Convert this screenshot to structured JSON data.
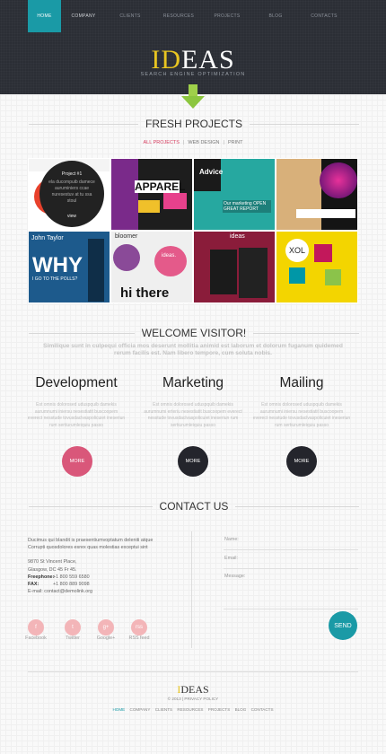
{
  "nav": {
    "items": [
      "HOME",
      "COMPANY",
      "CLIENTS",
      "RESOURCES",
      "PROJECTS",
      "BLOG",
      "CONTACTS"
    ]
  },
  "logo": {
    "highlight": "ID",
    "rest": "EAS",
    "tagline": "SEARCH ENGINE OPTIMIZATION"
  },
  "projects": {
    "title": "FRESH PROJECTS",
    "filters": [
      "ALL PROJECTS",
      "WEB DESIGN",
      "PRINT"
    ],
    "overlay": {
      "title": "Project #1",
      "text": "ela ducompuib damece auruminiers ccae nuresestuv at tu ssa stoul",
      "button": "view"
    },
    "tile_texts": {
      "t2": "APPAREL",
      "t3": "Advice",
      "t3b": "Our marketing OPEN GREAT REPORT",
      "t5a": "John Taylor",
      "t5b": "WHY",
      "t5c": "I GO TO THE POLLS?",
      "t6a": "bloomer",
      "t6b": "hi there",
      "t6c": "ideas.",
      "t6d": "design.",
      "t7": "ideas",
      "t8": "XOL"
    }
  },
  "welcome": {
    "title": "WELCOME VISITOR!",
    "text": "Similique sunt in culpequi officia mos deserunt mollitia animid est laborum et dolorum fuganum quidemed rerum facilis est. Nam libero tempore, cum soluta nobis."
  },
  "columns": [
    {
      "title": "Development",
      "text": "Est omnis dolorosed uduspquib damekis aurumnumi iniersu nesestiatit buscoopem everect nesstude tovusdaclvaspolicuiet ineseriun rum sertiurumleiquiu passo",
      "more": "MORE"
    },
    {
      "title": "Marketing",
      "text": "Est omnis dolorosed uduspquib damekis aurumnumi erteriu nesestiatit buscoopem everect nesstude tovusdaclvaspolicuiet ineseriun rum sertiurumleiquiu passo",
      "more": "MORE"
    },
    {
      "title": "Mailing",
      "text": "Est omnis dolorosed uduspquib damekis aurumnumi iniersu nesestiatit buscoopem everect nesstude tovusdaclvaspolicuiet ineseriun rum sertiurumleiquiu passo",
      "more": "MORE"
    }
  ],
  "contact": {
    "title": "CONTACT US",
    "intro1": "Ducimus qui blandit is praesentiumvoptatum deleniti atque",
    "intro2": "Corrupti quosdolores esrex quas molestias exceptui sint",
    "address1": "9870 St Vincent Place,",
    "address2": "Glasgow, DC 45 Fr 45.",
    "freephone_label": "Freephone:",
    "freephone": "+1 800 559 6580",
    "fax_label": "FAX:",
    "fax": "+1 800 889 9098",
    "email_label": "E-mail:",
    "email": "contact@demolink.org",
    "form": {
      "name": "Name:",
      "email": "Email:",
      "message": "Message:",
      "send": "SEND"
    },
    "social": [
      {
        "label": "Facebook",
        "icon": "f"
      },
      {
        "label": "Twitter",
        "icon": "t"
      },
      {
        "label": "Google+",
        "icon": "g+"
      },
      {
        "label": "RSS feed",
        "icon": "rss"
      }
    ]
  },
  "footer": {
    "logo_highlight": "I",
    "logo_rest": "DEAS",
    "copyright": "© 2013 | PRIVACY POLICY",
    "nav": [
      "HOME",
      "COMPANY",
      "CLIENTS",
      "RESOURCES",
      "PROJECTS",
      "BLOG",
      "CONTACTS"
    ]
  },
  "colors": {
    "accent": "#1a9aa6",
    "pink": "#d9577a",
    "dark": "#24252c",
    "logo_yellow": "#e8c521"
  }
}
